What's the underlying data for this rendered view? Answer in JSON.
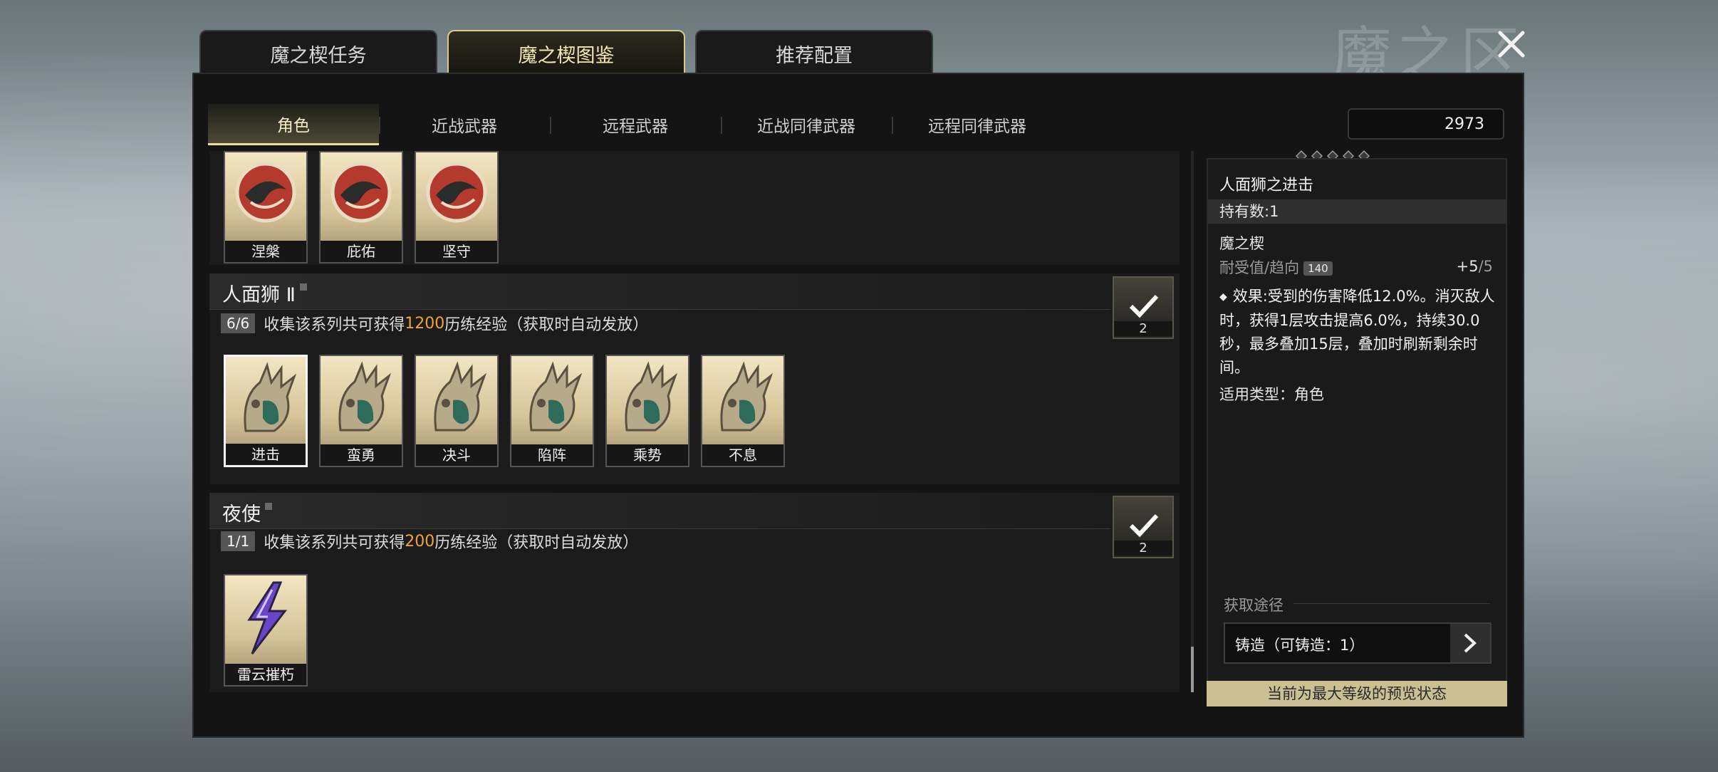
{
  "background": {
    "watermark": "魔之区"
  },
  "main_tabs": [
    {
      "label": "魔之楔任务",
      "active": false
    },
    {
      "label": "魔之楔图鉴",
      "active": true
    },
    {
      "label": "推荐配置",
      "active": false
    }
  ],
  "sub_tabs": [
    {
      "label": "角色",
      "active": true
    },
    {
      "label": "近战武器",
      "active": false
    },
    {
      "label": "远程武器",
      "active": false
    },
    {
      "label": "近战同律武器",
      "active": false
    },
    {
      "label": "远程同律武器",
      "active": false
    }
  ],
  "currency": {
    "amount": "2973",
    "icon": "bird-currency-icon"
  },
  "top_cards": [
    {
      "name": "涅槃",
      "icon": "red-swirl-emblem-icon"
    },
    {
      "name": "庇佑",
      "icon": "red-swirl-emblem-icon"
    },
    {
      "name": "坚守",
      "icon": "red-swirl-emblem-icon"
    }
  ],
  "groups": [
    {
      "title": "人面狮 Ⅱ",
      "progress_badge": "6/6",
      "progress_prefix": "收集该系列共可获得",
      "progress_amount": "1200",
      "progress_suffix": "历练经验（获取时自动发放）",
      "reward_count": "2",
      "cards": [
        {
          "name": "进击",
          "selected": true
        },
        {
          "name": "蛮勇",
          "selected": false
        },
        {
          "name": "决斗",
          "selected": false
        },
        {
          "name": "陷阵",
          "selected": false
        },
        {
          "name": "乘势",
          "selected": false
        },
        {
          "name": "不息",
          "selected": false
        }
      ]
    },
    {
      "title": "夜使",
      "progress_badge": "1/1",
      "progress_prefix": "收集该系列共可获得",
      "progress_amount": "200",
      "progress_suffix": "历练经验（获取时自动发放）",
      "reward_count": "2",
      "cards": [
        {
          "name": "雷云摧朽",
          "selected": false
        }
      ]
    }
  ],
  "detail": {
    "title": "人面狮之进击",
    "owned": "持有数:1",
    "category": "魔之楔",
    "durability_label": "耐受值/趋向",
    "durability_value": "140",
    "level_current": "+5",
    "level_max": "/5",
    "effect": "效果:受到的伤害降低12.0%。消灭敌人时，获得1层攻击提高6.0%，持续30.0秒，最多叠加15层，叠加时刷新剩余时间。",
    "applies_to": "适用类型：角色",
    "source_label": "获取途径",
    "source_button": "铸造（可铸造：1）",
    "preview_notice": "当前为最大等级的预览状态"
  },
  "colors": {
    "accent_gold": "#d9c98a",
    "highlight_orange": "#f0a23a",
    "preview_bar": "#cbbf94"
  }
}
